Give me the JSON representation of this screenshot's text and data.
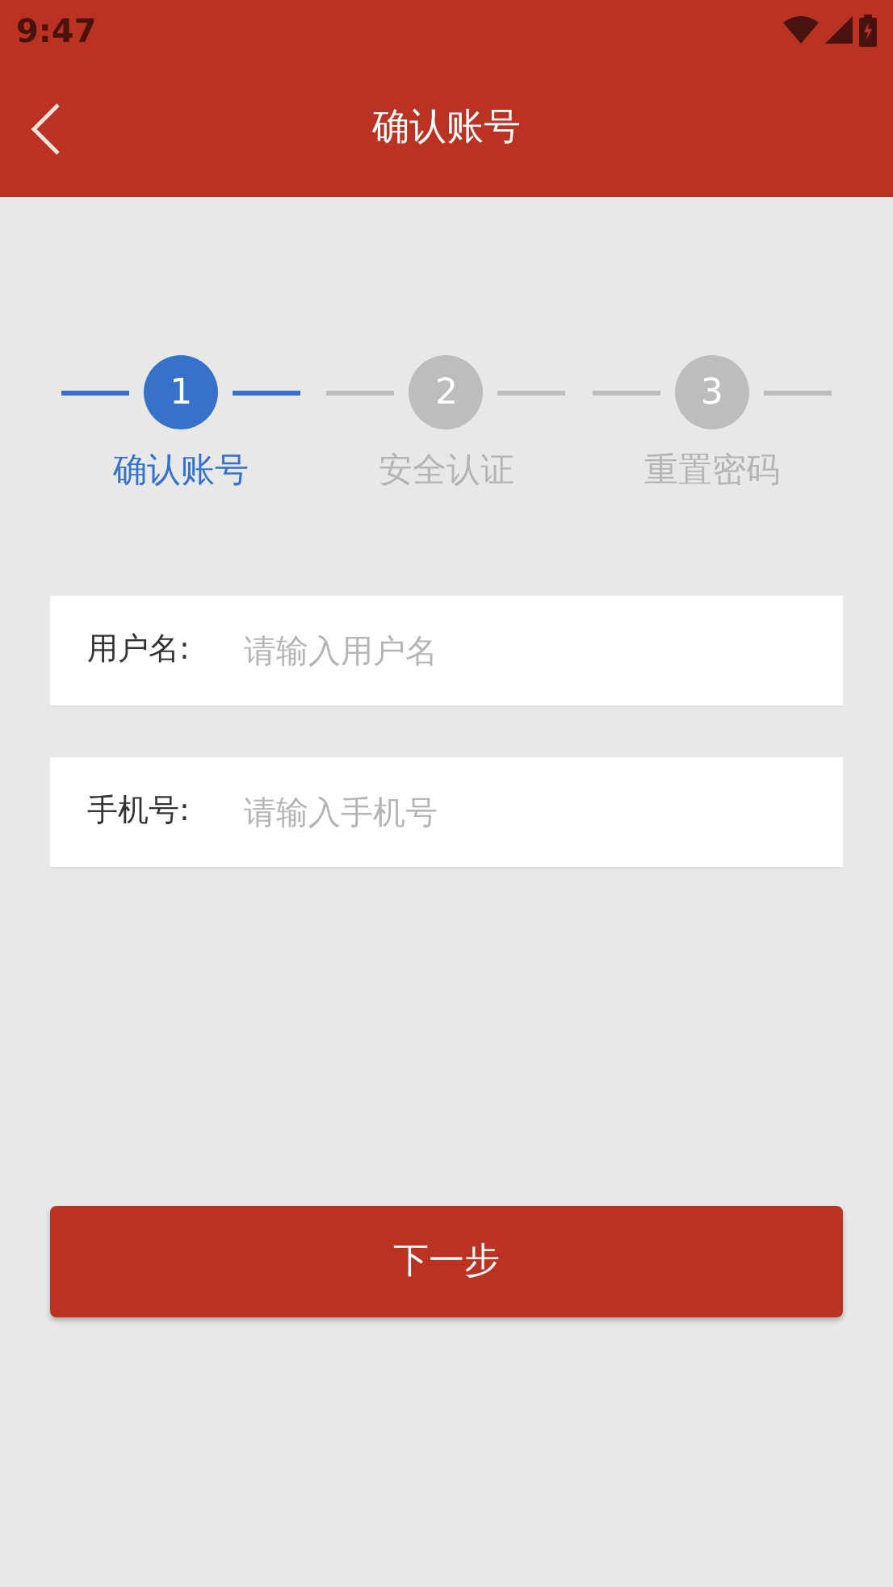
{
  "status_bar": {
    "time": "9:47"
  },
  "app_bar": {
    "title": "确认账号"
  },
  "steps": [
    {
      "number": "1",
      "label": "确认账号",
      "selected": true
    },
    {
      "number": "2",
      "label": "安全认证",
      "selected": false
    },
    {
      "number": "3",
      "label": "重置密码",
      "selected": false
    }
  ],
  "fields": [
    {
      "label": "用户名:",
      "placeholder": "请输入用户名"
    },
    {
      "label": "手机号:",
      "placeholder": "请输入手机号"
    }
  ],
  "next_button": {
    "label": "下一步"
  }
}
